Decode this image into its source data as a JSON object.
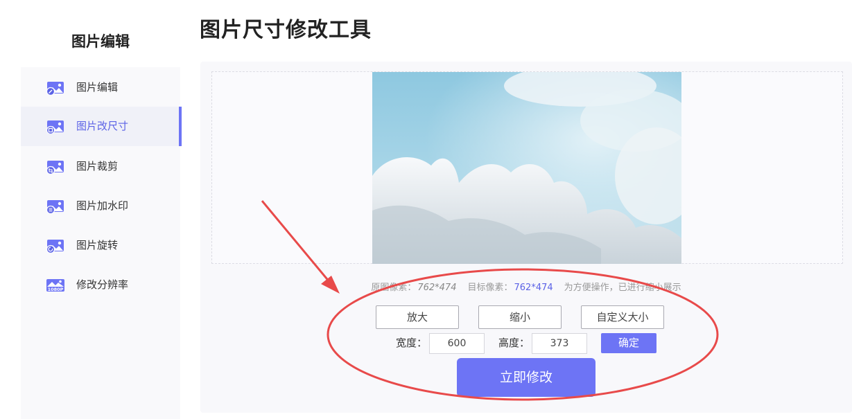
{
  "sidebar": {
    "title": "图片编辑",
    "items": [
      {
        "label": "图片编辑",
        "icon": "image-edit-icon"
      },
      {
        "label": "图片改尺寸",
        "icon": "image-resize-icon",
        "active": true
      },
      {
        "label": "图片裁剪",
        "icon": "image-crop-icon"
      },
      {
        "label": "图片加水印",
        "icon": "image-watermark-icon"
      },
      {
        "label": "图片旋转",
        "icon": "image-rotate-icon"
      },
      {
        "label": "修改分辨率",
        "icon": "image-resolution-icon",
        "badge": "1080P"
      }
    ]
  },
  "main": {
    "title": "图片尺寸修改工具",
    "info": {
      "original_label": "原图像素：",
      "original_value": "762*474",
      "target_label": "目标像素：",
      "target_value": "762*474",
      "note": "为方便操作，已进行缩小展示"
    },
    "buttons": {
      "enlarge": "放大",
      "shrink": "缩小",
      "custom": "自定义大小",
      "confirm": "确定",
      "apply": "立即修改"
    },
    "width_label": "宽度：",
    "width_value": "600",
    "height_label": "高度：",
    "height_value": "373"
  },
  "colors": {
    "accent": "#6d74f5",
    "annotation": "#e84a4a"
  }
}
